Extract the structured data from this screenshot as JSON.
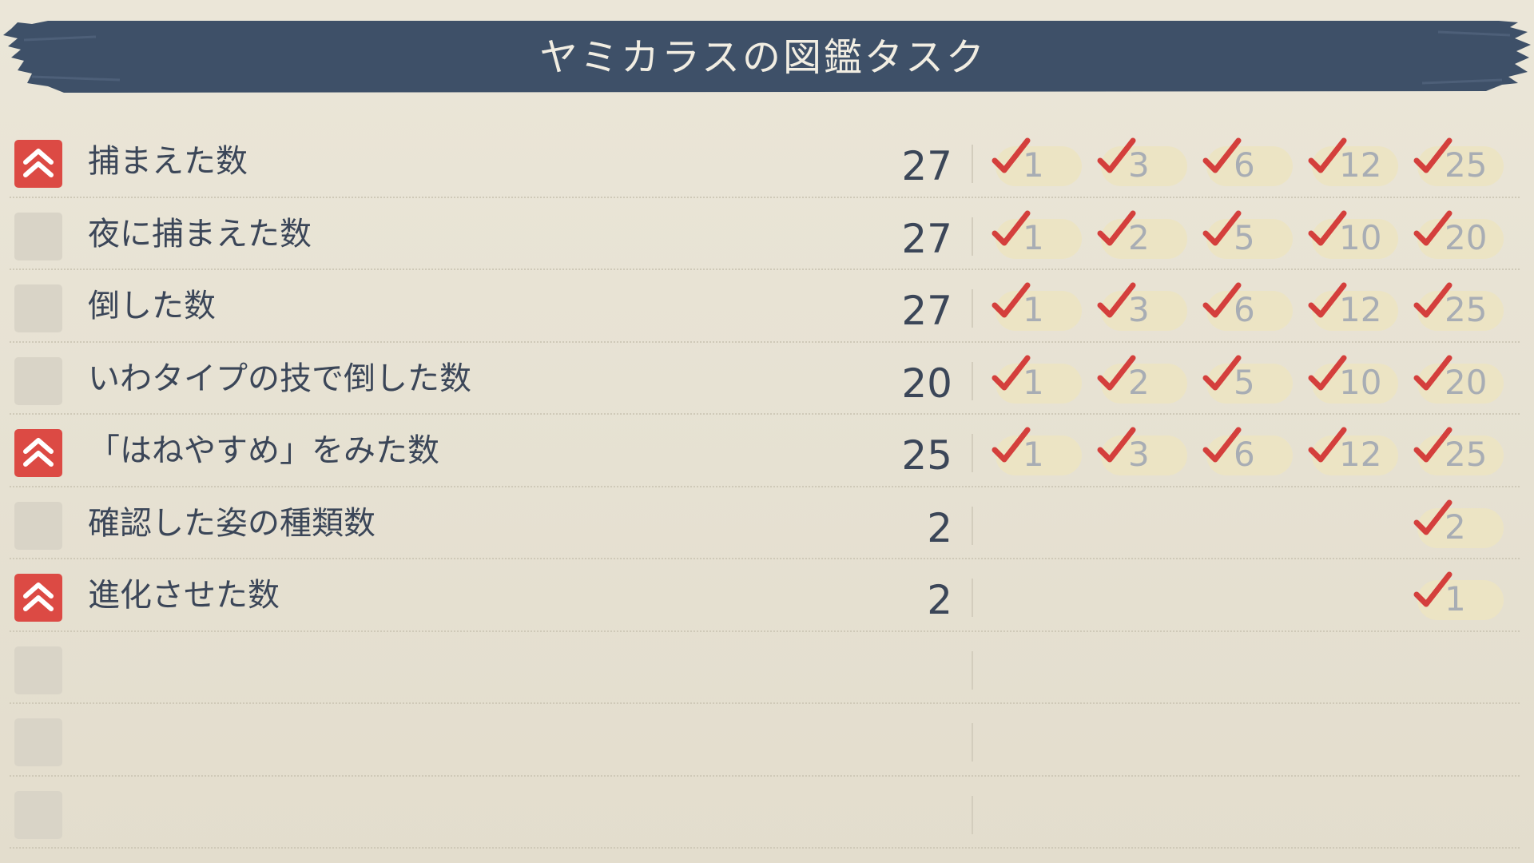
{
  "title": "ヤミカラスの図鑑タスク",
  "colors": {
    "banner": "#3e5068",
    "urgent_icon": "#dc4a44",
    "check": "#d43f3c",
    "goal_pill": "#ece4c4"
  },
  "tasks": [
    {
      "label": "捕まえた数",
      "count": "27",
      "urgent": true,
      "goals": [
        "1",
        "3",
        "6",
        "12",
        "25"
      ]
    },
    {
      "label": "夜に捕まえた数",
      "count": "27",
      "urgent": false,
      "goals": [
        "1",
        "2",
        "5",
        "10",
        "20"
      ]
    },
    {
      "label": "倒した数",
      "count": "27",
      "urgent": false,
      "goals": [
        "1",
        "3",
        "6",
        "12",
        "25"
      ]
    },
    {
      "label": "いわタイプの技で倒した数",
      "count": "20",
      "urgent": false,
      "goals": [
        "1",
        "2",
        "5",
        "10",
        "20"
      ]
    },
    {
      "label": "「はねやすめ」をみた数",
      "count": "25",
      "urgent": true,
      "goals": [
        "1",
        "3",
        "6",
        "12",
        "25"
      ]
    },
    {
      "label": "確認した姿の種類数",
      "count": "2",
      "urgent": false,
      "goals": [
        "2"
      ]
    },
    {
      "label": "進化させた数",
      "count": "2",
      "urgent": true,
      "goals": [
        "1"
      ]
    },
    {
      "label": "",
      "count": "",
      "urgent": false,
      "goals": []
    },
    {
      "label": "",
      "count": "",
      "urgent": false,
      "goals": []
    },
    {
      "label": "",
      "count": "",
      "urgent": false,
      "goals": []
    }
  ]
}
